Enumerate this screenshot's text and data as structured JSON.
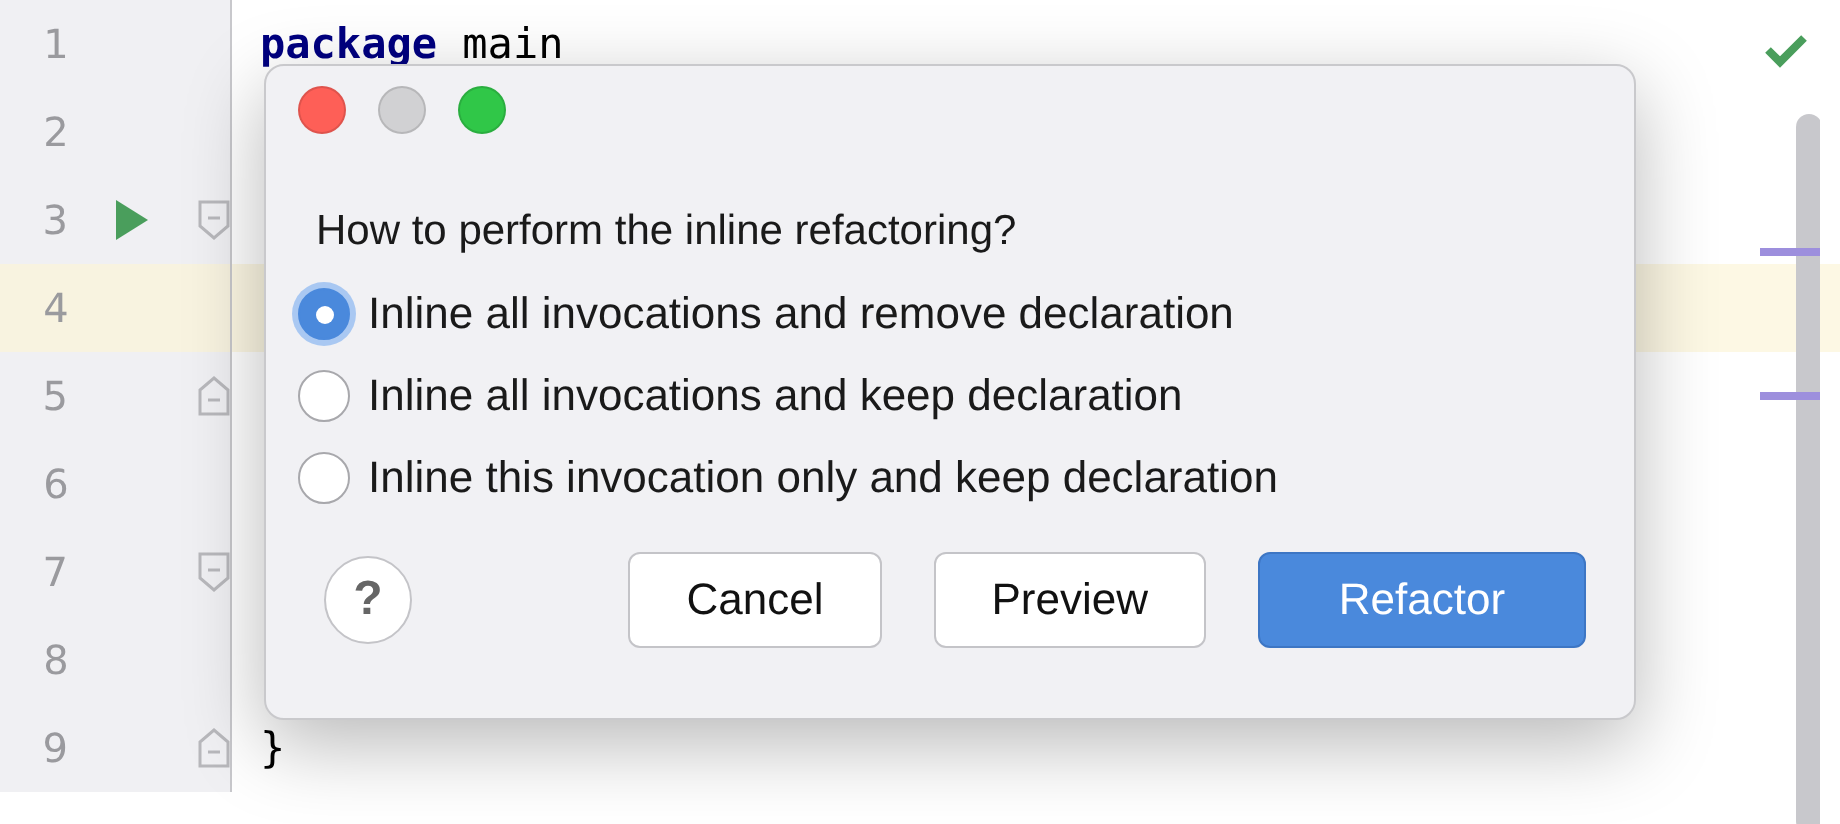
{
  "editor": {
    "lines": [
      {
        "number": "1",
        "code": "**package** main",
        "current": false,
        "run": false,
        "kind": "plain"
      },
      {
        "number": "2",
        "current": false,
        "run": false,
        "kind": "plain"
      },
      {
        "number": "3",
        "current": false,
        "run": true,
        "kind": "foldstart"
      },
      {
        "number": "4",
        "current": true,
        "run": false,
        "kind": "plain"
      },
      {
        "number": "5",
        "current": false,
        "run": false,
        "kind": "foldend"
      },
      {
        "number": "6",
        "current": false,
        "run": false,
        "kind": "plain"
      },
      {
        "number": "7",
        "current": false,
        "run": false,
        "kind": "foldstart"
      },
      {
        "number": "8",
        "current": false,
        "run": false,
        "kind": "plain"
      },
      {
        "number": "9",
        "code": "}",
        "current": false,
        "run": false,
        "kind": "foldend"
      }
    ],
    "inspection_ok": true
  },
  "dialog": {
    "question": "How to perform the inline refactoring?",
    "options": [
      {
        "label": "Inline all invocations and remove declaration",
        "selected": true
      },
      {
        "label": "Inline all invocations and keep declaration",
        "selected": false
      },
      {
        "label": "Inline this invocation only and keep declaration",
        "selected": false
      }
    ],
    "help": "?",
    "buttons": [
      {
        "label": "Cancel",
        "kind": "default"
      },
      {
        "label": "Preview",
        "kind": "default"
      },
      {
        "label": "Refactor",
        "kind": "primary"
      }
    ]
  }
}
